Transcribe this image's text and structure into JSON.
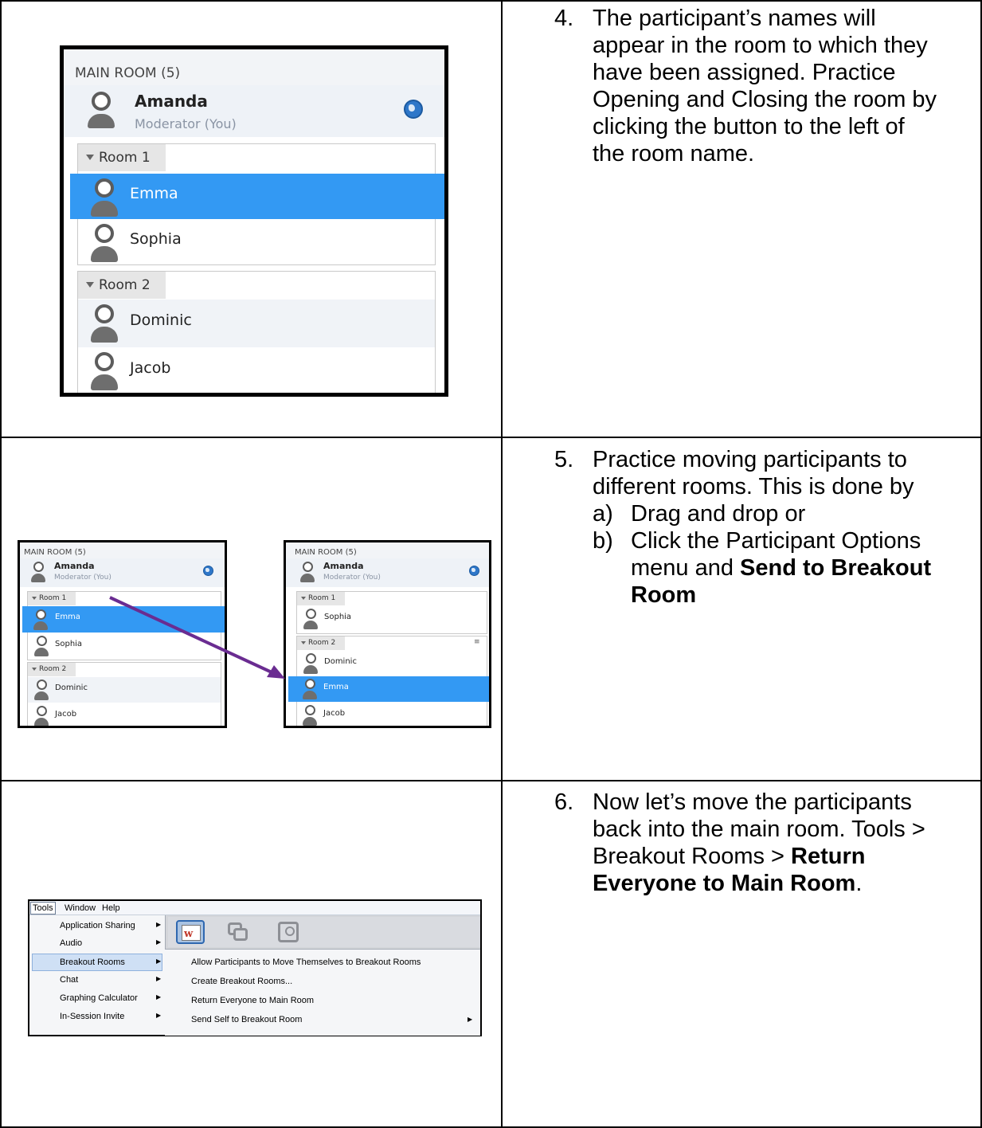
{
  "steps": [
    {
      "number": "4.",
      "lines": [
        "The participant’s names will",
        "appear in the room to which they",
        "have been assigned.  Practice",
        "Opening and Closing the room by",
        "clicking the button to the left of",
        "the room name."
      ]
    },
    {
      "number": "5.",
      "lines": [
        "Practice moving participants to",
        "different rooms.  This is done by"
      ],
      "option_a_label": "a)",
      "option_a": "Drag and drop or",
      "option_b_label": "b)",
      "option_b_line1": "Click the Participant Options",
      "option_b_line2_plain": "menu and ",
      "option_b_line2_bold": "Send to Breakout",
      "option_b_line3_bold": "Room"
    },
    {
      "number": "6.",
      "line1": "Now let’s move the participants",
      "line2": "back into the main room.  Tools >",
      "line3_plain": "Breakout Rooms > ",
      "line3_bold": "Return",
      "line4_bold": "Everyone to Main Room",
      "line4_end": "."
    }
  ],
  "panel_large": {
    "header": "MAIN ROOM (5)",
    "moderator_name": "Amanda",
    "moderator_role": "Moderator (You)",
    "room1": "Room 1",
    "room1_members": [
      "Emma",
      "Sophia"
    ],
    "room2": "Room 2",
    "room2_members": [
      "Dominic",
      "Jacob"
    ],
    "selected": "Emma",
    "colors": {
      "selected": "#3399f3",
      "header_bg": "#f2f4f7",
      "moderator_bg": "#eef2f7"
    }
  },
  "panel_before": {
    "header": "MAIN ROOM (5)",
    "moderator_name": "Amanda",
    "moderator_role": "Moderator (You)",
    "room1": "Room 1",
    "room1_members": [
      "Emma",
      "Sophia"
    ],
    "room2": "Room 2",
    "room2_members": [
      "Dominic",
      "Jacob"
    ]
  },
  "panel_after": {
    "header": "MAIN ROOM (5)",
    "moderator_name": "Amanda",
    "moderator_role": "Moderator (You)",
    "room1": "Room 1",
    "room1_members": [
      "Sophia"
    ],
    "room2": "Room 2",
    "room2_members": [
      "Dominic",
      "Emma",
      "Jacob"
    ],
    "options_icon": "list-options-icon"
  },
  "arrow_color": "#6a2c91",
  "menu": {
    "menubar": [
      "Tools",
      "Window",
      "Help"
    ],
    "tools_items": [
      "Application Sharing",
      "Audio",
      "Breakout Rooms",
      "Chat",
      "Graphing Calculator",
      "In-Session Invite"
    ],
    "highlighted_item": "Breakout Rooms",
    "breakout_submenu": [
      "Allow Participants to Move Themselves to Breakout Rooms",
      "Create Breakout Rooms...",
      "Return Everyone to Main Room",
      "Send Self to Breakout Room"
    ],
    "toolbar_icons": [
      "whiteboard-icon",
      "application-share-icon",
      "web-tour-icon"
    ]
  }
}
